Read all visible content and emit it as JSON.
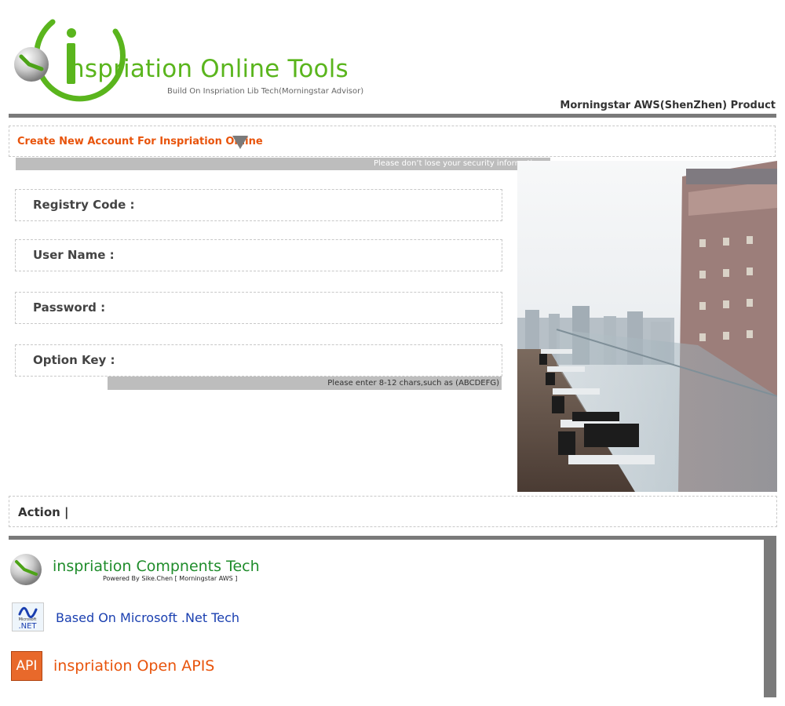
{
  "header": {
    "title": "nspriation Online Tools",
    "tagline": "Build On Inspriation Lib Tech(Morningstar Advisor)",
    "product": "Morningstar AWS(ShenZhen) Product",
    "logo_icon": "inspiration-logo",
    "colors": {
      "brand_green": "#5ab51d",
      "rule_gray": "#7a7a7a"
    }
  },
  "section": {
    "title": "Create New Account For Inspriation Online",
    "toggle_icon": "triangle-down",
    "security_notice": "Please don’t lose your security information .",
    "title_color": "#e8540c"
  },
  "form": {
    "fields": [
      {
        "label": "Registry Code :",
        "value": "",
        "placeholder": ""
      },
      {
        "label": "User Name :",
        "value": "",
        "placeholder": ""
      },
      {
        "label": "Password :",
        "value": "",
        "placeholder": ""
      },
      {
        "label": "Option Key :",
        "value": "",
        "placeholder": ""
      }
    ],
    "option_key_hint": "Please enter 8-12 chars,such as (ABCDEFG)"
  },
  "action": {
    "label": "Action |"
  },
  "footer": {
    "components": {
      "title": "inspriation Compnents Tech",
      "credit": "Powered By Sike.Chen [ Morningstar AWS ]",
      "icon": "inspiration-ball-icon"
    },
    "net": {
      "label": "Based On Microsoft .Net Tech",
      "icon": "dotnet-icon",
      "icon_small_text": "Microsoft",
      "icon_text": ".NET"
    },
    "api": {
      "label": "inspriation Open APIS",
      "icon_text": "API"
    }
  }
}
